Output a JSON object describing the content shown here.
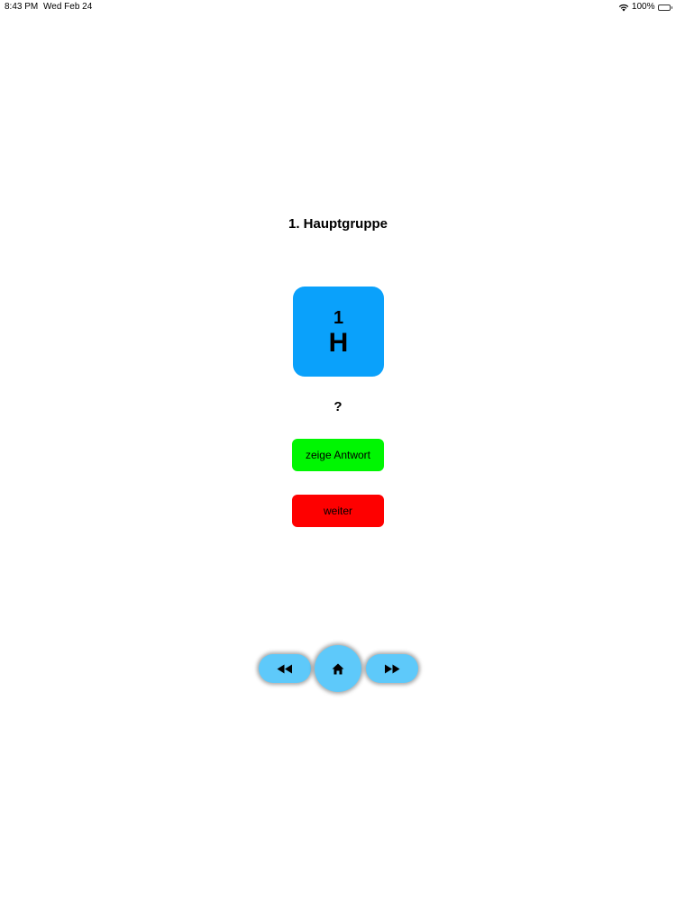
{
  "status_bar": {
    "time": "8:43 PM",
    "date": "Wed Feb 24",
    "battery": "100%"
  },
  "title": "1. Hauptgruppe",
  "element": {
    "number": "1",
    "symbol": "H",
    "color": "#0aa1fb"
  },
  "prompt": "?",
  "buttons": {
    "show_answer": "zeige Antwort",
    "next": "weiter"
  },
  "nav": {
    "back_icon": "rewind-icon",
    "home_icon": "home-icon",
    "forward_icon": "fast-forward-icon",
    "color": "#5ec9fa"
  }
}
